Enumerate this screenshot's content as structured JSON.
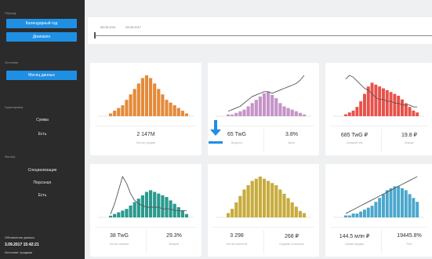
{
  "colors": {
    "sidebar_bg": "#2b2b2b",
    "accent": "#1f8fe3",
    "orange": "#e58a3a",
    "purple": "#c594c8",
    "red": "#e8514a",
    "teal": "#2a9a8e",
    "olive": "#c7ab3d",
    "blue": "#4aa7cc"
  },
  "sidebar": {
    "top_label": "Период",
    "buttons": [
      "Календарный год",
      "Диапазон"
    ],
    "section2_label": "Источник",
    "button3": "Месяц данных",
    "section3_label": "Группировка",
    "items_a": [
      "Сумма",
      "Есть"
    ],
    "section4_label": "Фильтр",
    "items_b": [
      "Специализация",
      "Персонал",
      "Есть"
    ],
    "footer_label": "Обновление данных",
    "footer_time": "3.09.2017 15:42:21",
    "footer_note": "Источник: продажи"
  },
  "range": {
    "date_from": "08.05.2011",
    "date_to": "28.06.2017"
  },
  "cards": [
    {
      "chart_data": {
        "type": "bar",
        "series": [
          {
            "values": [
              1,
              2,
              3,
              4,
              6,
              8,
              10,
              12,
              14,
              15,
              14,
              12,
              10,
              8,
              6,
              5,
              4,
              3,
              2,
              1
            ]
          }
        ],
        "line": []
      },
      "metrics": [
        {
          "value": "2 147M",
          "label": "Кол-во продаж"
        }
      ]
    },
    {
      "chart_data": {
        "type": "bar",
        "series": [
          {
            "values": [
              1,
              1,
              2,
              3,
              4,
              6,
              8,
              10,
              12,
              14,
              15,
              13,
              11,
              8,
              6,
              5,
              4,
              3,
              2,
              1
            ]
          }
        ],
        "line": [
          3,
          4,
          5,
          6,
          8,
          10,
          12,
          13,
          14,
          15,
          15,
          14,
          15,
          16,
          17,
          18,
          19,
          20,
          22,
          25
        ]
      },
      "metrics": [
        {
          "value": "65 TwG",
          "label": "Выручка"
        },
        {
          "value": "3.8%",
          "label": "Доля"
        }
      ]
    },
    {
      "chart_data": {
        "type": "bar",
        "series": [
          {
            "values": [
              1,
              2,
              3,
              5,
              8,
              12,
              16,
              18,
              17,
              16,
              15,
              14,
              13,
              12,
              11,
              9,
              7,
              5,
              3,
              2
            ]
          }
        ],
        "line": [
          20,
          22,
          21,
          19,
          17,
          15,
          14,
          12,
          10,
          9,
          9,
          8,
          8,
          7,
          7,
          6,
          6,
          6,
          5,
          5
        ]
      },
      "metrics": [
        {
          "value": "685 TwG ₽",
          "label": "Средний чек"
        },
        {
          "value": "19.8 ₽",
          "label": "Маржа"
        }
      ]
    },
    {
      "chart_data": {
        "type": "bar",
        "series": [
          {
            "values": [
              1,
              2,
              3,
              4,
              5,
              7,
              9,
              11,
              13,
              15,
              16,
              15,
              14,
              13,
              12,
              10,
              8,
              6,
              4,
              2
            ]
          }
        ],
        "line": [
          2,
          8,
          16,
          24,
          20,
          14,
          10,
          8,
          7,
          6,
          6,
          6,
          6,
          5,
          5,
          5,
          4,
          4,
          4,
          4
        ]
      },
      "metrics": [
        {
          "value": "38 TwG",
          "label": "Кол-во заказов"
        },
        {
          "value": "29.3%",
          "label": "Возврат"
        }
      ]
    },
    {
      "chart_data": {
        "type": "bar",
        "series": [
          {
            "values": [
              2,
              4,
              7,
              10,
              13,
              15,
              17,
              18,
              19,
              18,
              17,
              16,
              15,
              13,
              11,
              9,
              7,
              5,
              3,
              2
            ]
          }
        ],
        "line": []
      },
      "metrics": [
        {
          "value": "3 298",
          "label": "Кол-во клиентов"
        },
        {
          "value": "268 ₽",
          "label": "Средняя стоимость"
        }
      ]
    },
    {
      "chart_data": {
        "type": "bar",
        "series": [
          {
            "values": [
              1,
              1,
              2,
              2,
              3,
              4,
              5,
              6,
              8,
              10,
              12,
              14,
              15,
              16,
              16,
              15,
              14,
              12,
              10,
              8
            ]
          }
        ],
        "line": [
          2,
          3,
          4,
          5,
          6,
          7,
          8,
          9,
          10,
          11,
          12,
          13,
          14,
          15,
          16,
          17,
          18,
          19,
          20,
          21
        ]
      },
      "metrics": [
        {
          "value": "144.5 млн ₽",
          "label": "Сумма продаж"
        },
        {
          "value": "19445.8%",
          "label": "Рост"
        }
      ]
    }
  ]
}
